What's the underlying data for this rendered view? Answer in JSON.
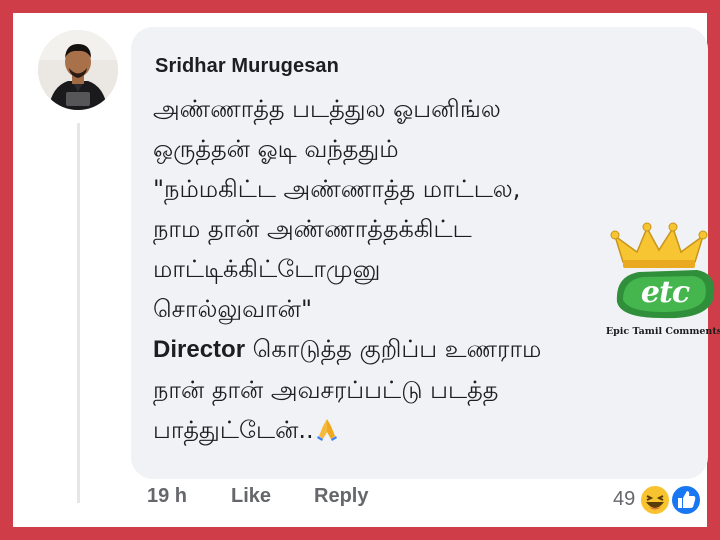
{
  "comment": {
    "author": "Sridhar Murugesan",
    "lines": [
      "அண்ணாத்த படத்துல ஓபனிங்ல",
      "ஒருத்தன் ஓடி வந்ததும்",
      "\"நம்மகிட்ட அண்ணாத்த மாட்டல,",
      "நாம தான் அண்ணாத்தக்கிட்ட",
      "மாட்டிக்கிட்டோமுனு",
      "சொல்லுவான்\""
    ],
    "line7_latin": "Director",
    "line7_rest": " கொடுத்த குறிப்ப உணராம",
    "line8": "நான் தான் அவசரப்பட்டு படத்த",
    "line9": "பாத்துட்டேன்..",
    "emoji": "folded-hands-emoji"
  },
  "actions": {
    "time": "19 h",
    "like": "Like",
    "reply": "Reply"
  },
  "reactions": {
    "count": "49",
    "icons": [
      "haha-icon",
      "like-icon"
    ]
  },
  "watermark": {
    "logo_text": "etc",
    "caption": "Epic Tamil Comments"
  },
  "colors": {
    "frame": "#cf3d48",
    "bubble": "#f0f2f5",
    "text": "#1c1e21",
    "meta": "#65676b",
    "like_blue": "#1877f2",
    "haha_yellow": "#f7c32e"
  }
}
